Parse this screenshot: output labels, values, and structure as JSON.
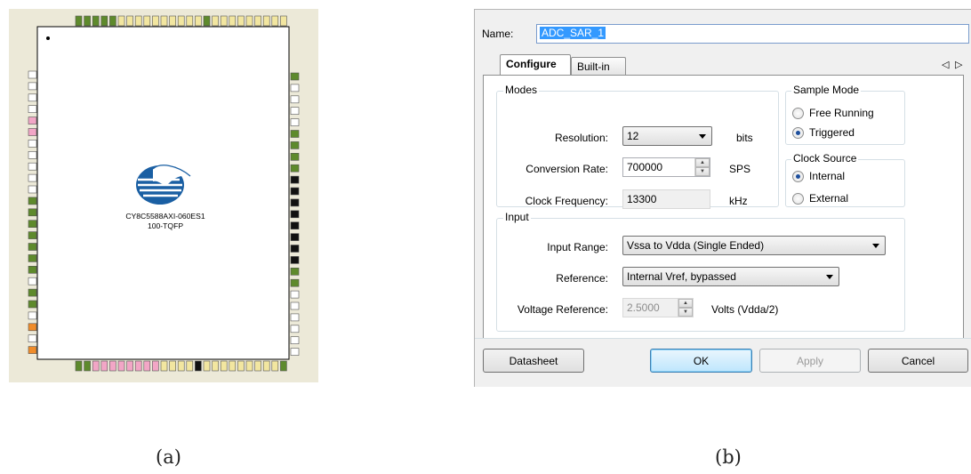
{
  "panel_a": {
    "caption": "(a)",
    "chip": {
      "part_number": "CY8C5588AXI-060ES1",
      "package": "100-TQFP",
      "logo": "cypress-tree-logo"
    }
  },
  "panel_b": {
    "caption": "(b)",
    "name_label": "Name:",
    "name_value": "ADC_SAR_1",
    "tabs": [
      {
        "label": "Configure",
        "active": true
      },
      {
        "label": "Built-in",
        "active": false
      }
    ],
    "tab_scroll_left": "◁",
    "tab_scroll_right": "▷",
    "modes": {
      "title": "Modes",
      "resolution_label": "Resolution:",
      "resolution_value": "12",
      "resolution_unit": "bits",
      "conversion_rate_label": "Conversion Rate:",
      "conversion_rate_value": "700000",
      "conversion_rate_unit": "SPS",
      "clock_frequency_label": "Clock Frequency:",
      "clock_frequency_value": "13300",
      "clock_frequency_unit": "kHz"
    },
    "sample_mode": {
      "title": "Sample Mode",
      "options": [
        {
          "label": "Free Running",
          "selected": false
        },
        {
          "label": "Triggered",
          "selected": true
        }
      ]
    },
    "clock_source": {
      "title": "Clock Source",
      "options": [
        {
          "label": "Internal",
          "selected": true
        },
        {
          "label": "External",
          "selected": false
        }
      ]
    },
    "input": {
      "title": "Input",
      "input_range_label": "Input Range:",
      "input_range_value": "Vssa to Vdda (Single Ended)",
      "reference_label": "Reference:",
      "reference_value": "Internal Vref, bypassed",
      "voltage_reference_label": "Voltage Reference:",
      "voltage_reference_value": "2.5000",
      "voltage_reference_unit": "Volts (Vdda/2)"
    },
    "buttons": {
      "datasheet": "Datasheet",
      "ok": "OK",
      "apply": "Apply",
      "cancel": "Cancel"
    }
  }
}
